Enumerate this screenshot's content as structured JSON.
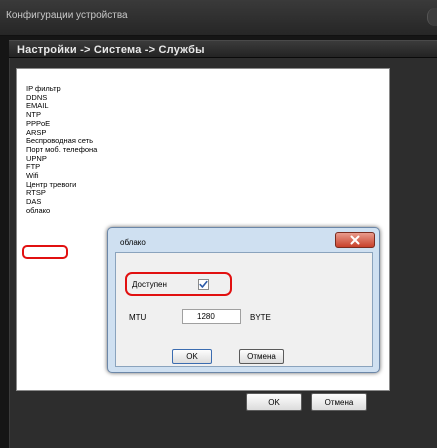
{
  "window": {
    "title": "Конфигурации устройства",
    "breadcrumb": "Настройки -> Система -> Службы"
  },
  "services": [
    "IP фильтр",
    "DDNS",
    "EMAIL",
    "NTP",
    "PPPoE",
    "ARSP",
    "Беспроводная сеть",
    "Порт моб. телефона",
    "UPNP",
    "FTP",
    "Wifi",
    "Центр тревоги",
    "RTSP",
    "DAS",
    "облако"
  ],
  "buttons": {
    "ok": "OK",
    "cancel": "Отмена"
  },
  "dialog": {
    "title": "облако",
    "enabled_label": "Доступен",
    "enabled_checked": true,
    "mtu_label": "MTU",
    "mtu_value": "1280",
    "mtu_unit": "BYTE",
    "ok": "OK",
    "cancel": "Отмена"
  },
  "colors": {
    "highlight": "#e11010",
    "dialog_frame": "#cfe0f1",
    "close_button": "#c8402a"
  },
  "icons": {
    "close": "close-x-icon",
    "checkmark": "checkmark-icon"
  }
}
